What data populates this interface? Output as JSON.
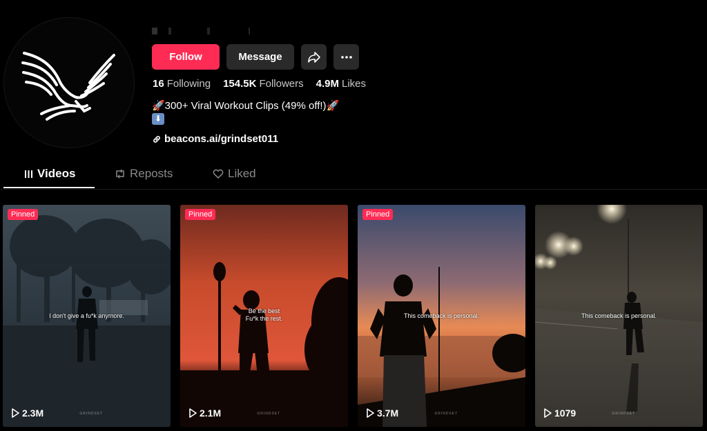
{
  "profile": {
    "follow_label": "Follow",
    "message_label": "Message",
    "stats": [
      {
        "value": "16",
        "label": "Following"
      },
      {
        "value": "154.5K",
        "label": "Followers"
      },
      {
        "value": "4.9M",
        "label": "Likes"
      }
    ],
    "bio_line1": "🚀300+ Viral Workout Clips (49% off!)🚀",
    "bio_line2": "⬇",
    "link": "beacons.ai/grindset011"
  },
  "icons": {
    "avatar": "eagle-logo",
    "share": "share-icon",
    "more": "more-icon",
    "link": "link-icon",
    "videos_tab": "grid-icon",
    "reposts_tab": "repost-icon",
    "liked_tab": "heart-icon",
    "play": "play-icon"
  },
  "tabs": [
    {
      "label": "Videos",
      "active": true
    },
    {
      "label": "Reposts",
      "active": false
    },
    {
      "label": "Liked",
      "active": false
    }
  ],
  "videos": [
    {
      "pinned_label": "Pinned",
      "caption": "I don't give a fu*k anymore.",
      "views": "2.3M",
      "watermark": "GRINDSET"
    },
    {
      "pinned_label": "Pinned",
      "caption": "Be the best\nFu*k the rest.",
      "views": "2.1M",
      "watermark": "GRINDSET"
    },
    {
      "pinned_label": "Pinned",
      "caption": "This comeback is personal.",
      "views": "3.7M",
      "watermark": "GRINDSET"
    },
    {
      "pinned_label": "",
      "caption": "This comeback is personal.",
      "views": "1079",
      "watermark": "GRINDSET"
    }
  ],
  "colors": {
    "accent": "#fe2c55",
    "button_dark": "#2a2a2a",
    "background": "#000000"
  }
}
